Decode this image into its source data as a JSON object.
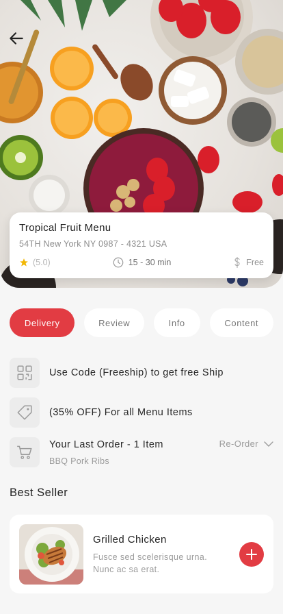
{
  "restaurant": {
    "name": "Tropical Fruit Menu",
    "address": "54TH New York  NY 0987 - 4321 USA",
    "rating": "(5.0)",
    "delivery_time": "15 - 30 min",
    "delivery_fee": "Free"
  },
  "tabs": [
    {
      "label": "Delivery",
      "active": true
    },
    {
      "label": "Review",
      "active": false
    },
    {
      "label": "Info",
      "active": false
    },
    {
      "label": "Content",
      "active": false
    }
  ],
  "promos": {
    "code_text": "Use Code (Freeship) to get free Ship",
    "discount_text": "(35% OFF) For all Menu Items"
  },
  "last_order": {
    "title": "Your Last Order - 1 Item",
    "item": "BBQ Pork Ribs",
    "action": "Re-Order"
  },
  "best_seller": {
    "section_title": "Best Seller",
    "items": [
      {
        "name": "Grilled Chicken",
        "description": "Fusce sed scelerisque urna. Nunc ac sa erat."
      }
    ]
  },
  "icons": {
    "back": "arrow-left-icon",
    "rating": "star-icon",
    "time": "clock-icon",
    "fee": "dollar-icon",
    "code": "qr-code-icon",
    "discount": "tag-icon",
    "order": "cart-icon",
    "reorder": "chevron-down-icon",
    "add": "plus-icon"
  },
  "colors": {
    "accent": "#e23c43",
    "star": "#f2b705",
    "background": "#f6f6f6"
  }
}
